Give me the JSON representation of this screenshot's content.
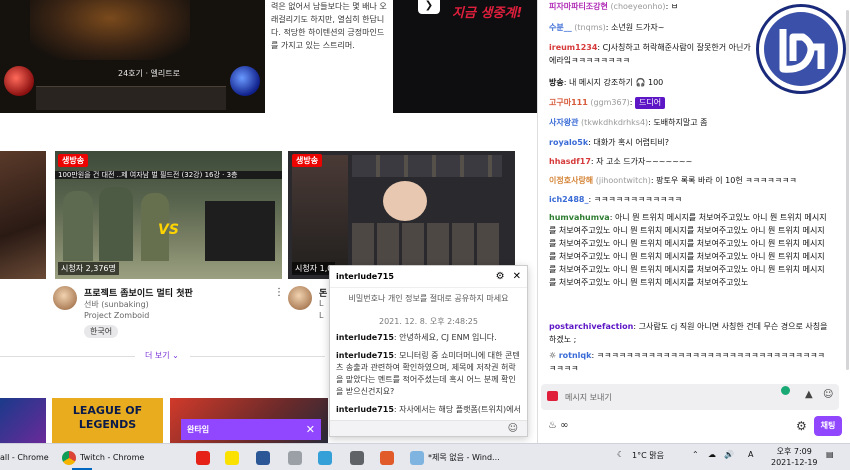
{
  "top": {
    "description": "력은 없어서 남들보다는 몇 배나 오래걸리기도 하지만, 열심히 한답니다. 적당한 하이텐션의 긍정마인드를 가지고 있는 스트리머.",
    "game_level": "24호기 · 엘리트로",
    "next_icon": "chevron-right-icon",
    "promo_text": "지금 생중계!"
  },
  "cards": [
    {
      "live": "생방송",
      "viewers": "시청자 2,376명",
      "overlay_top": "100만원을 건 대전 ..제 여자남 벌 필드전 (32강) 16강 · 3층",
      "vs": "VS",
      "title": "프로젝트 좀보이드 멀티 첫판",
      "channel": "선바 (sunbaking)",
      "category": "Project Zomboid",
      "tag": "한국어"
    },
    {
      "live": "생방송",
      "viewers": "시청자 1,0",
      "title": "돈",
      "channel": "L",
      "category": "L",
      "tag": ""
    }
  ],
  "more_label": "더 보기 ⌄",
  "league_text": "LEAGUE OF LEGENDS",
  "raid": {
    "label": "완타임",
    "close_icon": "close-icon"
  },
  "popout": {
    "name": "interlude715",
    "notice": "비밀번호나 개인 정보를 절대로 공유하지 마세요",
    "timestamp": "2021. 12. 8. 오후 2:48:25",
    "messages": [
      {
        "user": "interlude715",
        "text": "안녕하세요, CJ ENM 입니다."
      },
      {
        "user": "interlude715",
        "text": "모니터링 중 쇼미더머니에 대한 콘텐츠 송출과 관련하여 확인하였으며, 제목에 저작권 허락을 맡았다는 멘트를 적어주셨는데 혹시 어느 분께 확인을 받으신건지요?"
      },
      {
        "user": "interlude715",
        "text": "자사에서는 해당 플랫폼(트위치)에서"
      }
    ]
  },
  "chat": {
    "lines": [
      {
        "user": "피자마파티조강현",
        "id": "(choeyeonho)",
        "text": "ㅂ",
        "color": "#b22fb8"
      },
      {
        "user": "수분__",
        "id": "(tnqms)",
        "text": "소년원 드가자~",
        "color": "#3a6bd6"
      },
      {
        "user": "ireum1234",
        "id": "",
        "text": "CJ사칭하고 허락해준사람이 잘못한거 아닌가",
        "color": "#d63a3a"
      },
      {
        "user": "",
        "id": "",
        "text": "에라잌ㅋㅋㅋㅋㅋㅋㅋㅋ",
        "color": "#111"
      },
      {
        "user": "방송",
        "id": "",
        "text": "내 메시지 강조하기 🎧 100",
        "color": "#111"
      },
      {
        "user": "고구마111",
        "id": "(ggm367)",
        "text": "",
        "chip": "드디어",
        "color": "#d65a3a"
      },
      {
        "user": "사자왕관",
        "id": "(tkwkdhkdrhks4)",
        "text": "도배하지말고 좀",
        "color": "#3a6bd6"
      },
      {
        "user": "royalo5k",
        "id": "",
        "text": "대화가 혹시 어렵티비?",
        "color": "#3a6bd6"
      },
      {
        "user": "hhasdf17",
        "id": "",
        "text": "자 고소 드가자~~~~~~~",
        "color": "#d63a3a"
      },
      {
        "user": "이정호사랑해",
        "id": "(jihoontwitch)",
        "text": "팡토우 록록 바라 이 10헌 ㅋㅋㅋㅋㅋㅋㅋ",
        "color": "#d6863a"
      },
      {
        "user": "ich2488_",
        "id": "",
        "text": "ㅋㅋㅋㅋㅋㅋㅋㅋㅋㅋㅋㅋ",
        "color": "#3a6bd6"
      },
      {
        "user": "humvahumva",
        "id": "",
        "text": "아니 뭔 트위치 메시지를 처보여주고있노 아니 뭔 트위치 메시지를 처보여주고있노 아니 뭔 트위치 메시지를 처보여주고있노 아니 뭔 트위치 메시지를 처보여주고있노 아니 뭔 트위치 메시지를 처보여주고있노 아니 뭔 트위치 메시지를 처보여주고있노 아니 뭔 트위치 메시지를 처보여주고있노 아니 뭔 트위치 메시지를 처보여주고있노 아니 뭔 트위치 메시지를 처보여주고있노 아니 뭔 트위치 메시지를 처보여주고있노 아니 뭔 트위치 메시지를 처보여주고있노",
        "color": "#2e7d32"
      },
      {
        "user": "postarchivefaction",
        "id": "",
        "text": "그사람도 cj 직원 아니면 사칭한 건데 무슨 경으로 사칭을 하겠노 ;",
        "color": "#5c16c5"
      },
      {
        "user": "rotnlqk",
        "id": "",
        "text": "ㅋㅋㅋㅋㅋㅋㅋㅋㅋㅋㅋㅋㅋㅋㅋㅋㅋㅋㅋㅋㅋㅋㅋㅋㅋㅋㅋㅋㅋㅋㅋㅋㅋㅋㅋ",
        "color": "#3a6bd6"
      }
    ],
    "input_placeholder": "메시지 보내기",
    "points": "∞",
    "send_label": "채팅"
  },
  "taskbar": {
    "items": [
      {
        "label": "all - Chrome",
        "icon": "chrome-icon"
      },
      {
        "label": "Twitch - Chrome",
        "icon": "chrome-icon"
      },
      {
        "label": "*제목 없음 - Wind...",
        "icon": "notepad-icon"
      }
    ],
    "weather": "1°C 맑음",
    "lang": "A",
    "time": "오후 7:09",
    "date": "2021-12-19"
  }
}
